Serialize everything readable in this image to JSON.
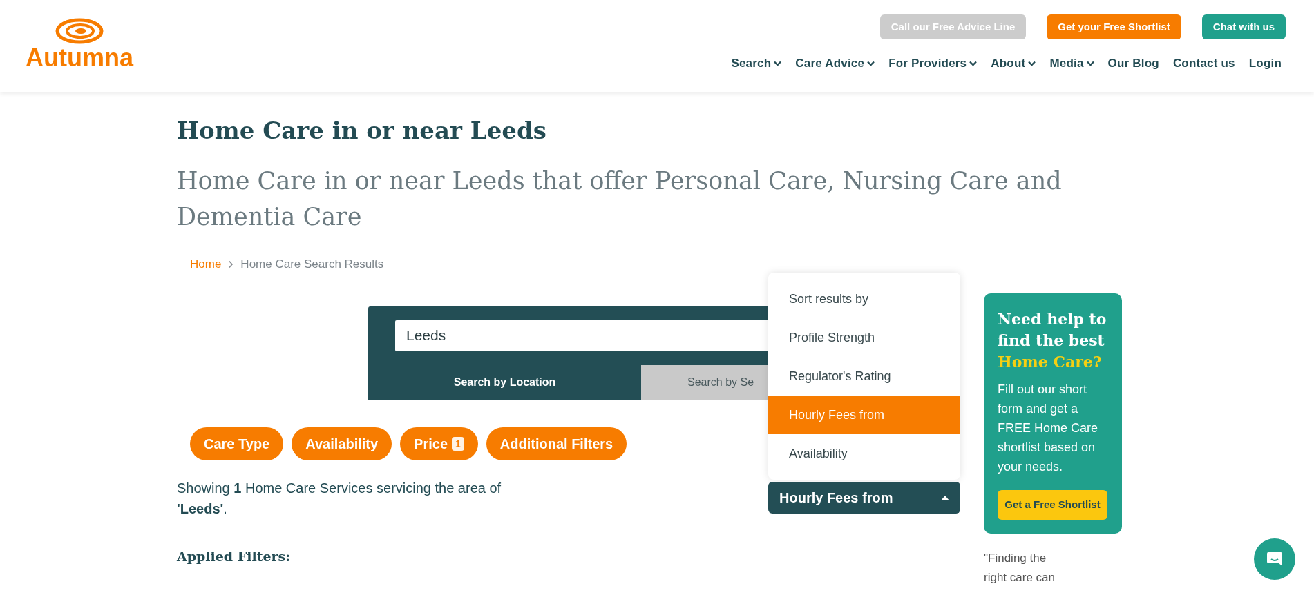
{
  "header": {
    "logo_text": "Autumna",
    "top_buttons": [
      {
        "label": "Call our Free Advice Line",
        "kind": "grey"
      },
      {
        "label": "Get your Free Shortlist",
        "kind": "orange"
      },
      {
        "label": "Chat with us",
        "kind": "teal"
      }
    ],
    "nav": [
      {
        "label": "Search",
        "has_menu": true
      },
      {
        "label": "Care Advice",
        "has_menu": true
      },
      {
        "label": "For Providers",
        "has_menu": true
      },
      {
        "label": "About",
        "has_menu": true
      },
      {
        "label": "Media",
        "has_menu": true
      },
      {
        "label": "Our Blog",
        "has_menu": false
      },
      {
        "label": "Contact us",
        "has_menu": false
      },
      {
        "label": "Login",
        "has_menu": false
      }
    ]
  },
  "title": "Home Care in or near Leeds",
  "subtitle": "Home Care in or near Leeds that offer Personal Care, Nursing Care and Dementia Care",
  "breadcrumb": [
    {
      "label": "Home",
      "kind": "link"
    },
    {
      "label": "Home Care Search Results",
      "kind": "current"
    }
  ],
  "search": {
    "value": "Leeds",
    "tabs": [
      {
        "label": "Search by Location",
        "selected": true
      },
      {
        "label": "Search by Se",
        "selected": false
      }
    ]
  },
  "filters": [
    {
      "label": "Care Type"
    },
    {
      "label": "Availability"
    },
    {
      "label": "Price",
      "badge": "1"
    },
    {
      "label": "Additional Filters"
    }
  ],
  "results_text": "Showing **1** Home Care Services servicing the area of **'Leeds'**.",
  "applied_filters_heading": "Applied Filters:",
  "sort": {
    "label": "Hourly Fees from",
    "expanded": true,
    "options": [
      {
        "label": "Sort results by",
        "selected": false
      },
      {
        "label": "Profile Strength",
        "selected": false
      },
      {
        "label": "Regulator's Rating",
        "selected": false
      },
      {
        "label": "Hourly Fees from",
        "selected": true
      },
      {
        "label": "Availability",
        "selected": false
      }
    ]
  },
  "sidebar": {
    "heading": "Need help to find the best",
    "heading_highlight": "Home Care?",
    "body": "Fill out our short form and get a FREE Home Care shortlist based on your needs.",
    "button": "Get a Free Shortlist",
    "quote": "\"Finding the right care can"
  }
}
